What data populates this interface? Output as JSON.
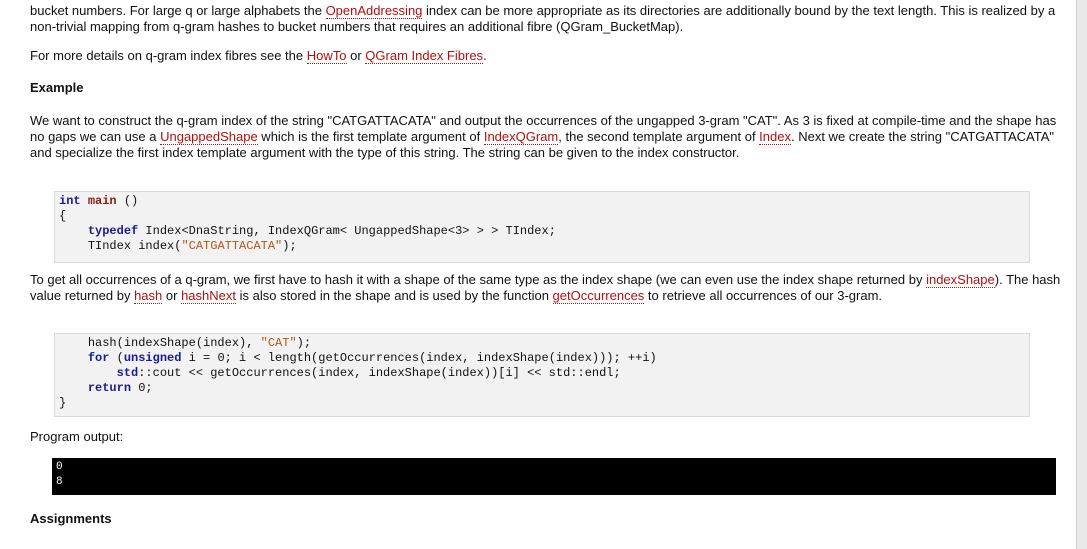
{
  "intro": {
    "t1": "bucket numbers. For large q or large alphabets the ",
    "link1": "OpenAddressing",
    "t2": " index can be more appropriate as its directories are additionally bound by the text length. This is realized by a non-trivial mapping from q-gram hashes to bucket numbers that requires an additional fibre (QGram_BucketMap)."
  },
  "more": {
    "t1": "For more details on q-gram index fibres see the ",
    "link1": "HowTo",
    "t2": " or ",
    "link2": "QGram Index Fibres",
    "t3": "."
  },
  "example_heading": "Example",
  "want": {
    "t1": "We want to construct the q-gram index of the string \"CATGATTACATA\" and output the occurrences of the ungapped 3-gram \"CAT\". As 3 is fixed at compile-time and the shape has no gaps we can use a ",
    "link1": "UngappedShape",
    "t2": " which is the first template argument of ",
    "link2": "IndexQGram",
    "t3": ", the second template argument of ",
    "link3": "Index",
    "t4": ". Next we create the string \"CATGATTACATA\" and specialize the first index template argument with the type of this string. The string can be given to the index constructor."
  },
  "code1": {
    "l1_kw": "int",
    "l1_name": "main",
    "l1_rest": " ()",
    "l2": "{",
    "l3_kw": "typedef",
    "l3_rest": " Index<DnaString, IndexQGram< UngappedShape<3> > > TIndex;",
    "l4_a": "TIndex index(",
    "l4_str": "\"CATGATTACATA\"",
    "l4_b": ");"
  },
  "get": {
    "t1": "To get all occurrences of a q-gram, we first have to hash it with a shape of the same type as the index shape (we can even use the index shape returned by ",
    "link1": "indexShape",
    "t2": "). The hash value returned by ",
    "link2": "hash",
    "t3": " or ",
    "link3": "hashNext",
    "t4": " is also stored in the shape and is used by the function ",
    "link4": "getOccurrences",
    "t5": " to retrieve all occurrences of our 3-gram."
  },
  "code2": {
    "l1_a": "hash(indexShape(index), ",
    "l1_str": "\"CAT\"",
    "l1_b": ");",
    "l2_kw": "for",
    "l2_a": " (",
    "l2_kw2": "unsigned",
    "l2_b": " i = 0; i < length(getOccurrences(index, indexShape(index))); ++i)",
    "l3_ns": "std",
    "l3_a": "::cout << getOccurrences(index, indexShape(index))[i] << std::endl;",
    "l4_kw": "return",
    "l4_b": " 0;",
    "close": "}"
  },
  "output_label": "Program output:",
  "output": {
    "line1": "0",
    "line2": "8"
  },
  "assignments_heading": "Assignments"
}
